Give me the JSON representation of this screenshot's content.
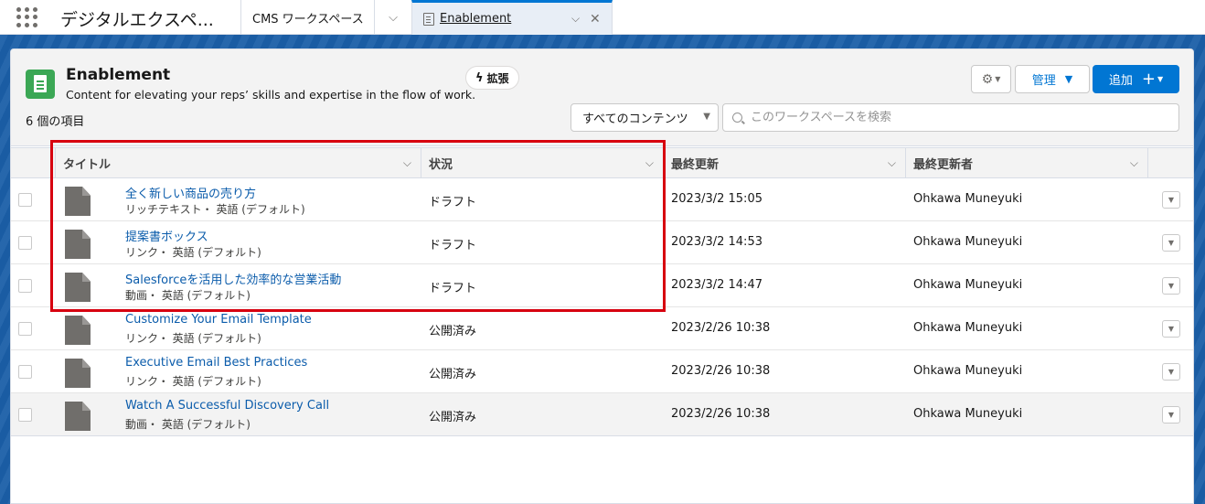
{
  "topbar": {
    "app_name": "デジタルエクスペ...",
    "tabs": [
      {
        "label": "CMS ワークスペース"
      },
      {
        "label": "Enablement"
      }
    ]
  },
  "header": {
    "title": "Enablement",
    "subtitle": "Content for elevating your reps’ skills and expertise in the flow of work.",
    "expand_label": "拡張",
    "count": "6 個の項目",
    "manage_label": "管理",
    "add_label": "追加",
    "filter_value": "すべてのコンテンツ",
    "search_placeholder": "このワークスペースを検索"
  },
  "table": {
    "columns": [
      "タイトル",
      "状況",
      "最終更新",
      "最終更新者"
    ],
    "rows": [
      {
        "title": "全く新しい商品の売り方",
        "meta": "リッチテキスト・ 英語 (デフォルト)",
        "status": "ドラフト",
        "updated": "2023/3/2 15:05",
        "updater": "Ohkawa Muneyuki"
      },
      {
        "title": "提案書ボックス",
        "meta": "リンク・ 英語 (デフォルト)",
        "status": "ドラフト",
        "updated": "2023/3/2 14:53",
        "updater": "Ohkawa Muneyuki"
      },
      {
        "title": "Salesforceを活用した効率的な営業活動",
        "meta": "動画・ 英語 (デフォルト)",
        "status": "ドラフト",
        "updated": "2023/3/2 14:47",
        "updater": "Ohkawa Muneyuki"
      },
      {
        "title": "Customize Your Email Template",
        "meta": "リンク・ 英語 (デフォルト)",
        "status": "公開済み",
        "updated": "2023/2/26 10:38",
        "updater": "Ohkawa Muneyuki"
      },
      {
        "title": "Executive Email Best Practices",
        "meta": "リンク・ 英語 (デフォルト)",
        "status": "公開済み",
        "updated": "2023/2/26 10:38",
        "updater": "Ohkawa Muneyuki"
      },
      {
        "title": "Watch A Successful Discovery Call",
        "meta": "動画・ 英語 (デフォルト)",
        "status": "公開済み",
        "updated": "2023/2/26 10:38",
        "updater": "Ohkawa Muneyuki"
      }
    ]
  },
  "icons": {
    "app_launcher": "app-launcher-icon",
    "content_type": "document-icon",
    "settings": "gear-icon",
    "expand": "bolt-icon",
    "search": "search-icon"
  },
  "colors": {
    "brand": "#0176d3",
    "link": "#0b5cab",
    "object_icon": "#3ba755",
    "highlight": "#d7000f"
  }
}
